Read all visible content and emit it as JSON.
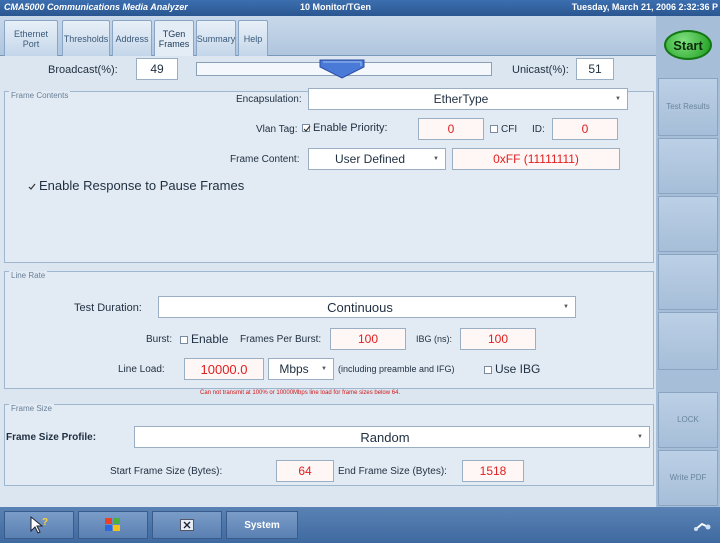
{
  "titlebar": {
    "app": "CMA5000 Communications Media Analyzer",
    "mode": "10 Monitor/TGen",
    "datetime": "Tuesday, March 21, 2006 2:32:36 P"
  },
  "tabs": [
    {
      "label": "Ethernet Port"
    },
    {
      "label": "Thresholds"
    },
    {
      "label": "Address"
    },
    {
      "label": "TGen Frames",
      "active": true
    },
    {
      "label": "Summary"
    },
    {
      "label": "Help"
    }
  ],
  "frame_contents": {
    "title": "Frame Contents",
    "broadcast_label": "Broadcast(%):",
    "broadcast_value": "49",
    "unicast_label": "Unicast(%):",
    "unicast_value": "51",
    "broadcast_fraction": 0.49,
    "encapsulation_label": "Encapsulation:",
    "encapsulation_value": "EtherType",
    "vlan_label": "Vlan Tag:",
    "enable_priority_label": "Enable Priority:",
    "enable_priority_checked": true,
    "priority_value": "0",
    "cfi_label": "CFI",
    "id_label": "ID:",
    "id_value": "0",
    "frame_content_label": "Frame Content:",
    "frame_content_value": "User Defined",
    "frame_content_pattern": "0xFF (11111111)",
    "pause_label": "Enable Response to Pause Frames",
    "pause_checked": true
  },
  "line_rate": {
    "title": "Line Rate",
    "test_duration_label": "Test Duration:",
    "test_duration_value": "Continuous",
    "burst_label": "Burst:",
    "enable_label": "Enable",
    "frames_per_burst_label": "Frames Per Burst:",
    "frames_per_burst_value": "100",
    "ibg_label": "IBG (ns):",
    "ibg_value": "100",
    "line_load_label": "Line Load:",
    "line_load_value": "10000.0",
    "unit_value": "Mbps",
    "including_label": "(including preamble and IFG)",
    "use_ibg_label": "Use IBG",
    "warning": "Can not transmit at 100% or 10000Mbps line load for frame sizes below 64."
  },
  "frame_size": {
    "title": "Frame Size",
    "profile_label": "Frame Size Profile:",
    "profile_value": "Random",
    "start_label": "Start Frame Size (Bytes):",
    "start_value": "64",
    "end_label": "End Frame Size (Bytes):",
    "end_value": "1518"
  },
  "side": {
    "start": "Start",
    "test_results": "Test Results",
    "lock": "LOCK",
    "write_pdf": "Write PDF"
  },
  "taskbar": {
    "system": "System"
  },
  "colors": {
    "accent_red": "#e02020",
    "start_green": "#1a9a1a"
  }
}
